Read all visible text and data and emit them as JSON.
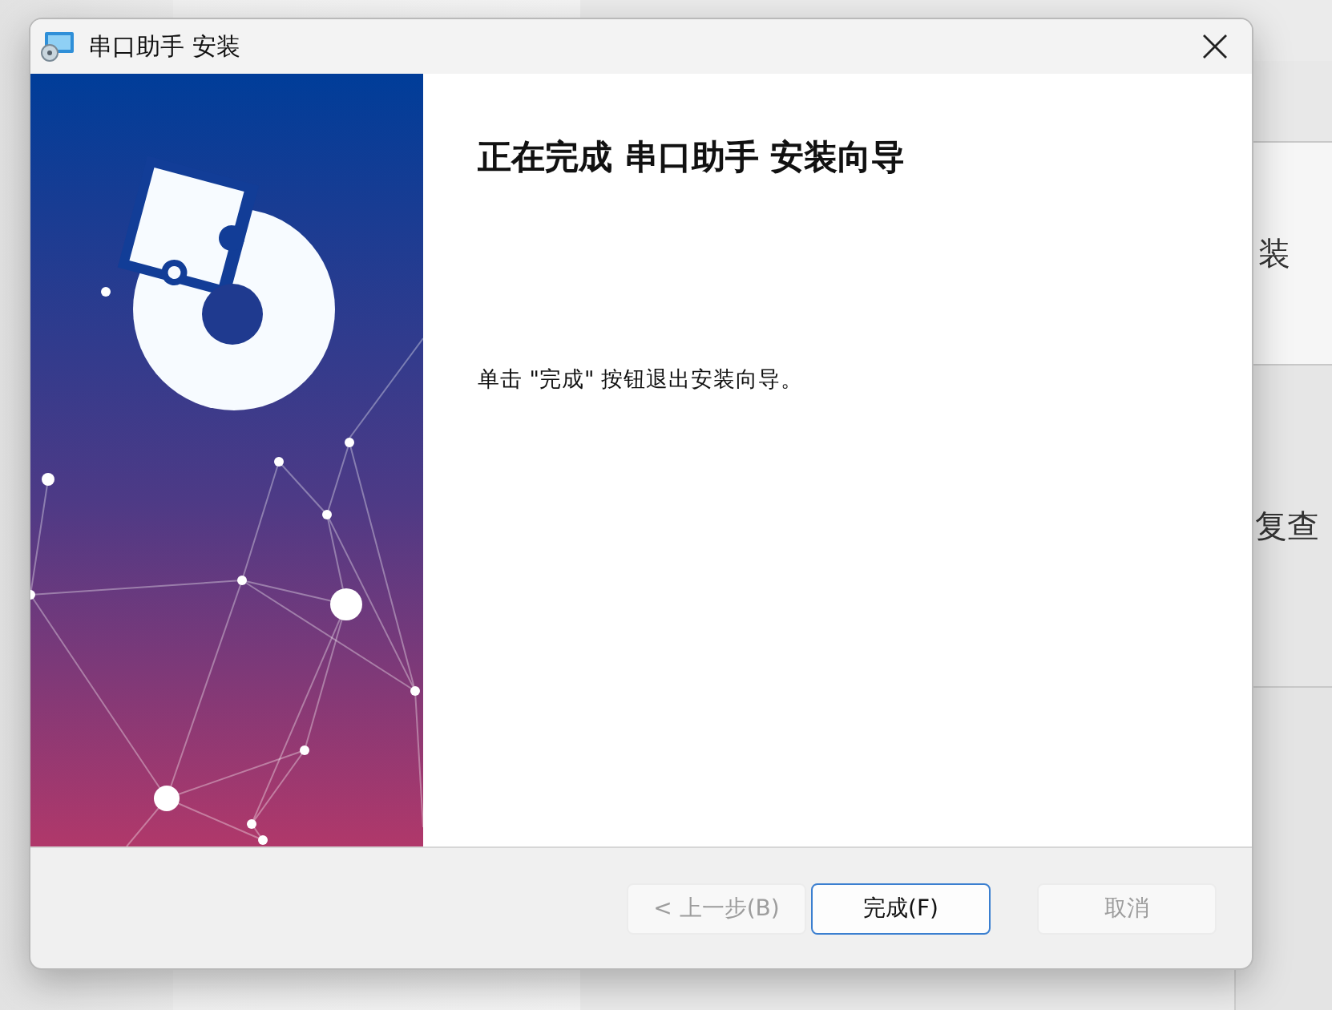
{
  "background": {
    "fragments": [
      "装",
      "复查"
    ]
  },
  "window": {
    "title": "串口助手 安装"
  },
  "heading": "正在完成 串口助手 安装向导",
  "message": "单击 \"完成\" 按钮退出安装向导。",
  "buttons": [
    {
      "label": "< 上一步(B)",
      "disabled": true,
      "focused": false
    },
    {
      "label": "完成(F)",
      "disabled": false,
      "focused": true
    },
    {
      "label": "取消",
      "disabled": true,
      "focused": false
    }
  ]
}
